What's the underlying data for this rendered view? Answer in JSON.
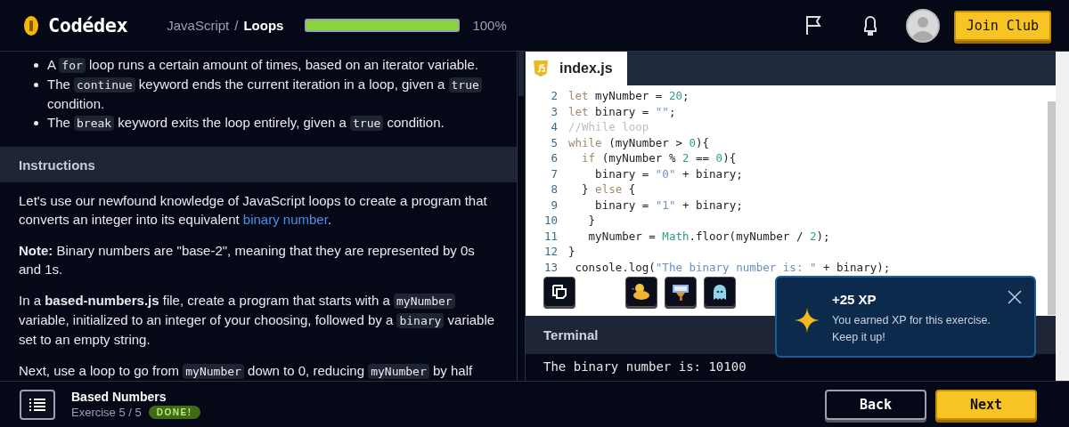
{
  "header": {
    "logo": "Codédex",
    "breadcrumb": [
      {
        "text": "JavaScript",
        "current": false
      },
      {
        "text": "/",
        "current": false
      },
      {
        "text": "Loops",
        "current": true
      }
    ],
    "progress": {
      "level": 1,
      "reading": "100%"
    },
    "join_button": "Join Club"
  },
  "lesson": {
    "bullets": [
      [
        {
          "kind": "text",
          "text": "A "
        },
        {
          "kind": "code",
          "text": "for"
        },
        {
          "kind": "text",
          "text": " loop runs a certain amount of times, based on an iterator variable."
        }
      ],
      [
        {
          "kind": "text",
          "text": "The "
        },
        {
          "kind": "code",
          "text": "continue"
        },
        {
          "kind": "text",
          "text": " keyword ends the current iteration in a loop, given a "
        },
        {
          "kind": "code",
          "text": "true"
        },
        {
          "kind": "text",
          "text": " condition."
        }
      ],
      [
        {
          "kind": "text",
          "text": "The "
        },
        {
          "kind": "code",
          "text": "break"
        },
        {
          "kind": "text",
          "text": " keyword exits the loop entirely, given a "
        },
        {
          "kind": "code",
          "text": "true"
        },
        {
          "kind": "text",
          "text": " condition."
        }
      ]
    ],
    "section_title": "Instructions",
    "paragraphs": [
      [
        {
          "kind": "text",
          "text": "Let's use our newfound knowledge of JavaScript loops to create a program that converts an integer into its equivalent "
        },
        {
          "kind": "link",
          "text": "binary number"
        },
        {
          "kind": "text",
          "text": "."
        }
      ],
      [
        {
          "kind": "bold",
          "text": "Note:"
        },
        {
          "kind": "text",
          "text": " Binary numbers are \"base-2\", meaning that they are represented by 0s and 1s."
        }
      ],
      [
        {
          "kind": "text",
          "text": "In a "
        },
        {
          "kind": "bold",
          "text": "based-numbers.js"
        },
        {
          "kind": "text",
          "text": " file, create a program that starts with a "
        },
        {
          "kind": "code",
          "text": "myNumber"
        },
        {
          "kind": "text",
          "text": " variable, initialized to an integer of your choosing, followed by a "
        },
        {
          "kind": "code",
          "text": "binary"
        },
        {
          "kind": "text",
          "text": " variable set to an empty string."
        }
      ],
      [
        {
          "kind": "text",
          "text": "Next, use a loop to go from "
        },
        {
          "kind": "code",
          "text": "myNumber"
        },
        {
          "kind": "text",
          "text": " down to 0, reducing "
        },
        {
          "kind": "code",
          "text": "myNumber"
        },
        {
          "kind": "text",
          "text": " by half"
        }
      ]
    ]
  },
  "editor": {
    "tabs": [
      {
        "label": "index.js",
        "selected": true
      }
    ],
    "lines": [
      {
        "number": "2",
        "tokens": [
          {
            "kind": "keyword",
            "text": "let"
          },
          {
            "kind": "plain",
            "text": " myNumber = "
          },
          {
            "kind": "number",
            "text": "20"
          },
          {
            "kind": "plain",
            "text": ";"
          }
        ]
      },
      {
        "number": "3",
        "tokens": [
          {
            "kind": "keyword",
            "text": "let"
          },
          {
            "kind": "plain",
            "text": " binary = "
          },
          {
            "kind": "string",
            "text": "\"\""
          },
          {
            "kind": "plain",
            "text": ";"
          }
        ]
      },
      {
        "number": "4",
        "tokens": [
          {
            "kind": "comment",
            "text": "//While loop"
          }
        ]
      },
      {
        "number": "5",
        "tokens": [
          {
            "kind": "keyword",
            "text": "while"
          },
          {
            "kind": "plain",
            "text": " (myNumber > "
          },
          {
            "kind": "number",
            "text": "0"
          },
          {
            "kind": "plain",
            "text": "){"
          }
        ]
      },
      {
        "number": "6",
        "tokens": [
          {
            "kind": "keyword",
            "text": "  if"
          },
          {
            "kind": "plain",
            "text": " (myNumber % "
          },
          {
            "kind": "number",
            "text": "2"
          },
          {
            "kind": "plain",
            "text": " == "
          },
          {
            "kind": "number",
            "text": "0"
          },
          {
            "kind": "plain",
            "text": "){"
          }
        ]
      },
      {
        "number": "7",
        "tokens": [
          {
            "kind": "plain",
            "text": "    binary = "
          },
          {
            "kind": "string",
            "text": "\"0\""
          },
          {
            "kind": "plain",
            "text": " + binary;"
          }
        ]
      },
      {
        "number": "8",
        "tokens": [
          {
            "kind": "plain",
            "text": "  } "
          },
          {
            "kind": "keyword",
            "text": "else"
          },
          {
            "kind": "plain",
            "text": " {"
          }
        ]
      },
      {
        "number": "9",
        "tokens": [
          {
            "kind": "plain",
            "text": "    binary = "
          },
          {
            "kind": "string",
            "text": "\"1\""
          },
          {
            "kind": "plain",
            "text": " + binary;"
          }
        ]
      },
      {
        "number": "10",
        "tokens": [
          {
            "kind": "plain",
            "text": "   }"
          }
        ]
      },
      {
        "number": "11",
        "tokens": [
          {
            "kind": "plain",
            "text": "   myNumber = "
          },
          {
            "kind": "number",
            "text": "Math"
          },
          {
            "kind": "plain",
            "text": ".floor(myNumber / "
          },
          {
            "kind": "number",
            "text": "2"
          },
          {
            "kind": "plain",
            "text": ");"
          }
        ]
      },
      {
        "number": "12",
        "tokens": [
          {
            "kind": "plain",
            "text": "}"
          }
        ]
      },
      {
        "number": "13",
        "tokens": [
          {
            "kind": "plain",
            "text": " console.log("
          },
          {
            "kind": "string",
            "text": "\"The binary number is: \""
          },
          {
            "kind": "plain",
            "text": " + binary);"
          }
        ]
      }
    ],
    "terminal": {
      "title": "Terminal",
      "output": [
        "The binary number is: 10100"
      ]
    }
  },
  "toast": {
    "title": "+25 XP",
    "message": "You earned XP for this exercise. Keep it up!"
  },
  "footer": {
    "title": "Based Numbers",
    "exercise": "Exercise 5 / 5",
    "badge": "DONE!",
    "buttons": [
      {
        "label": "Back",
        "kind": "secondary"
      },
      {
        "label": "Next",
        "kind": "primary"
      }
    ]
  }
}
